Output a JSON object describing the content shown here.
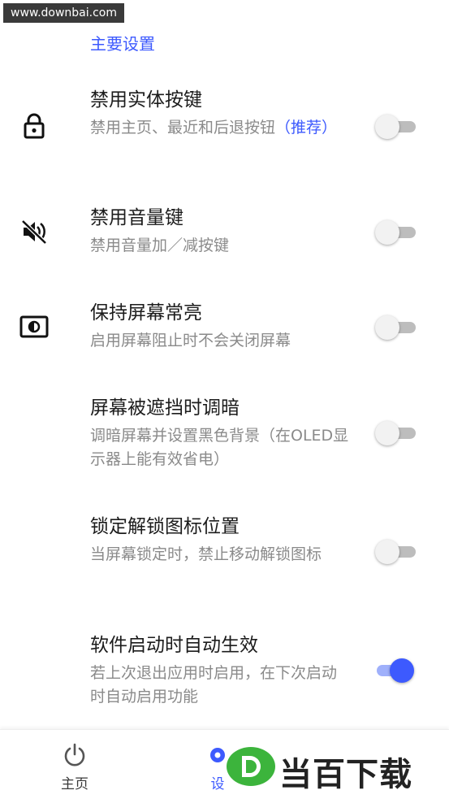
{
  "watermark": "www.downbai.com",
  "section_title": "主要设置",
  "settings": [
    {
      "title": "禁用实体按键",
      "desc": "禁用主页、最近和后退按钮",
      "desc_accent": "（推荐）",
      "icon": "lock-icon",
      "enabled": false
    },
    {
      "title": "禁用音量键",
      "desc": "禁用音量加／减按键",
      "icon": "volume-off-icon",
      "enabled": false
    },
    {
      "title": "保持屏幕常亮",
      "desc": "启用屏幕阻止时不会关闭屏幕",
      "icon": "brightness-screen-icon",
      "enabled": false
    },
    {
      "title": "屏幕被遮挡时调暗",
      "desc": "调暗屏幕并设置黑色背景（在OLED显示器上能有效省电）",
      "icon": "",
      "enabled": false
    },
    {
      "title": "锁定解锁图标位置",
      "desc": "当屏幕锁定时，禁止移动解锁图标",
      "icon": "",
      "enabled": false
    },
    {
      "title": "软件启动时自动生效",
      "desc": "若上次退出应用时启用，在下次启动时自动启用功能",
      "icon": "",
      "enabled": true
    }
  ],
  "bottom_nav": {
    "home_label": "主页",
    "settings_label": "设"
  },
  "brand_watermark": "当百下载",
  "colors": {
    "accent": "#3d5afe",
    "brand_green": "#3cb43c"
  }
}
